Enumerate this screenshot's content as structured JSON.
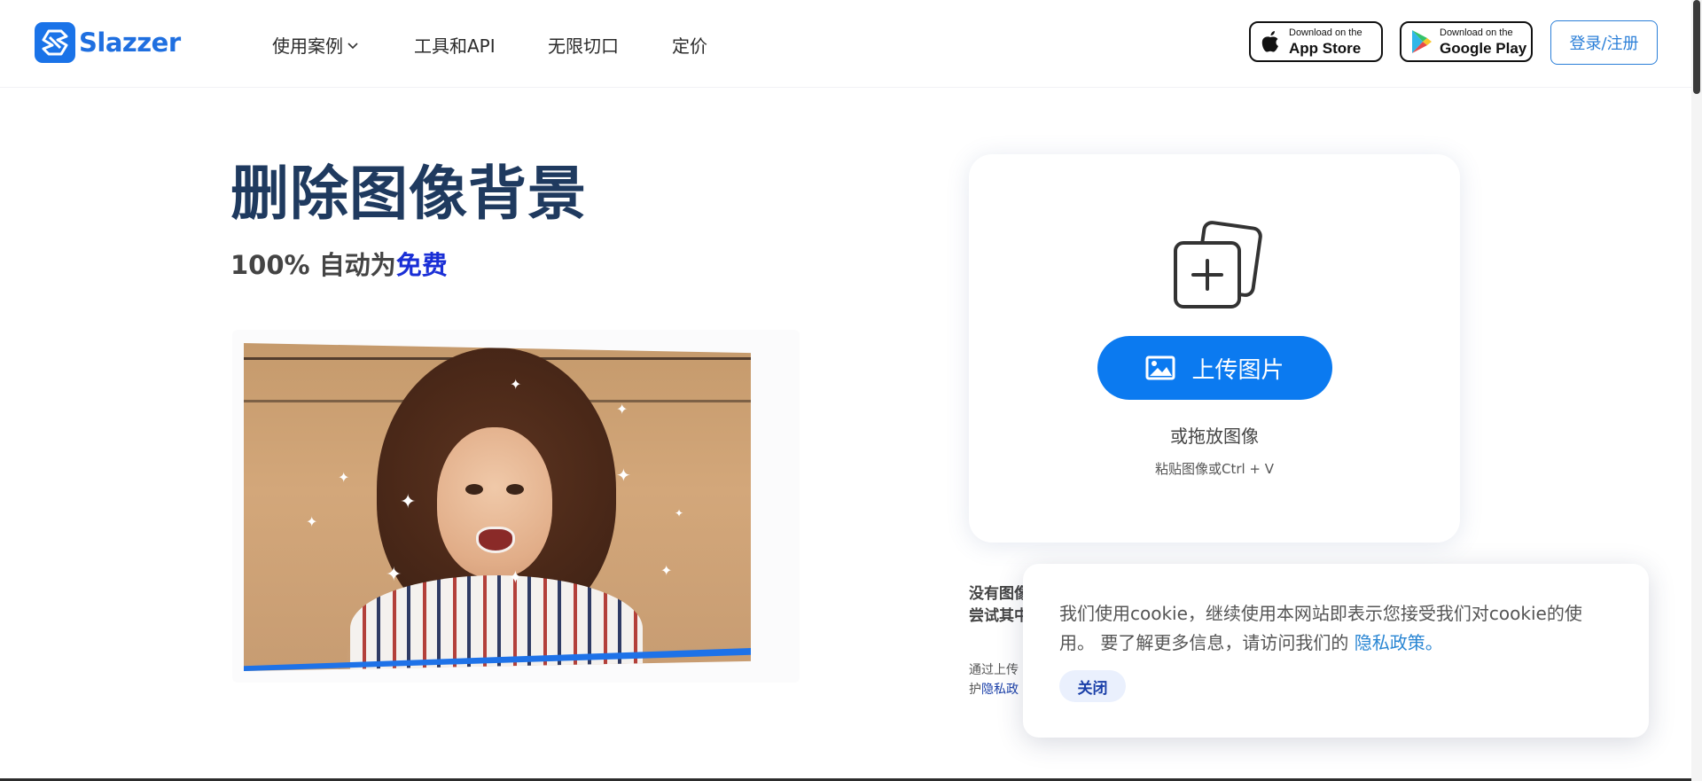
{
  "brand": {
    "name": "Slazzer",
    "color": "#1a73e8"
  },
  "nav": {
    "items": [
      {
        "label": "使用案例",
        "has_dropdown": true
      },
      {
        "label": "工具和API",
        "has_dropdown": false
      },
      {
        "label": "无限切口",
        "has_dropdown": false
      },
      {
        "label": "定价",
        "has_dropdown": false
      }
    ]
  },
  "stores": {
    "apple": {
      "small": "Download on the",
      "big": "App Store",
      "icon": "apple-icon"
    },
    "google": {
      "small": "Download on the",
      "big": "Google Play",
      "icon": "google-play-icon"
    }
  },
  "login_label": "登录/注册",
  "hero": {
    "title": "删除图像背景",
    "subtitle_prefix": "100% 自动为",
    "subtitle_highlight": "免费"
  },
  "upload": {
    "button_label": "上传图片",
    "drop_text": "或拖放图像",
    "paste_text": "粘贴图像或Ctrl + V"
  },
  "samples": {
    "line1": "没有图像",
    "line2": "尝试其中"
  },
  "terms": {
    "line1": "通过上传",
    "line2_prefix": "护",
    "line2_link": "隐私政"
  },
  "cookie": {
    "text": "我们使用cookie，继续使用本网站即表示您接受我们对cookie的使用。 要了解更多信息，请访问我们的 ",
    "link": "隐私政策。",
    "close_label": "关闭"
  },
  "colors": {
    "accent": "#0b7af0",
    "title": "#1f3a5f",
    "free_highlight": "#1a2fd6",
    "link": "#2a86d3"
  }
}
